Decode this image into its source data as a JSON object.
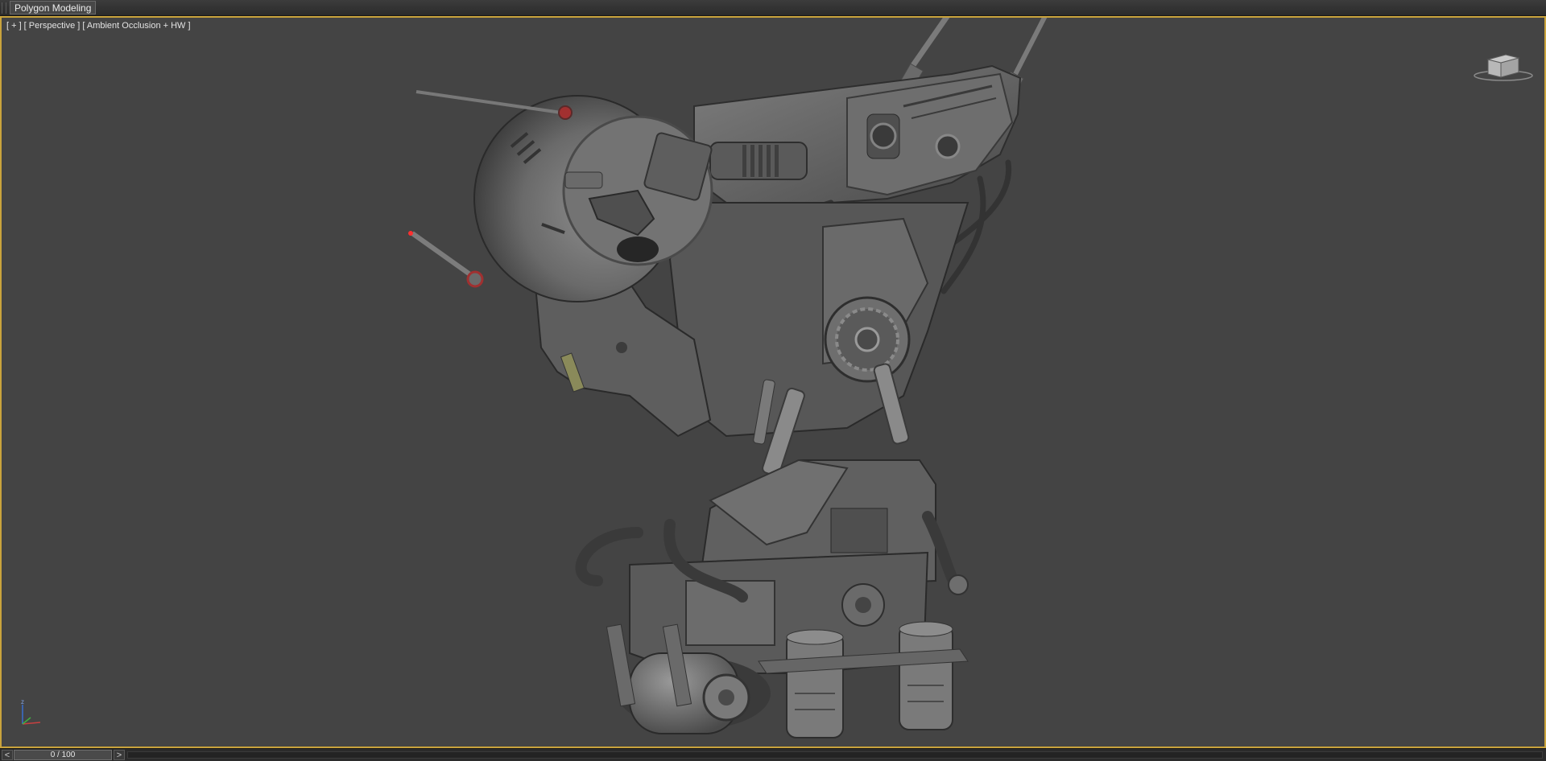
{
  "ribbon": {
    "tab_label": "Polygon Modeling"
  },
  "viewport": {
    "menu_plus": "[ + ]",
    "view_label": "[ Perspective ]",
    "shading_label": "[ Ambient Occlusion + HW ]",
    "border_color": "#c9a33c",
    "background_color": "#444444"
  },
  "icons": {
    "viewcube": "viewcube-icon",
    "axis": "axis-tripod-icon",
    "prev": "chevron-left-icon",
    "next": "chevron-right-icon"
  },
  "axis": {
    "z_label": "z"
  },
  "timeline": {
    "prev_label": "<",
    "next_label": ">",
    "frame_display": "0 / 100",
    "current_frame": 0,
    "total_frames": 100
  }
}
